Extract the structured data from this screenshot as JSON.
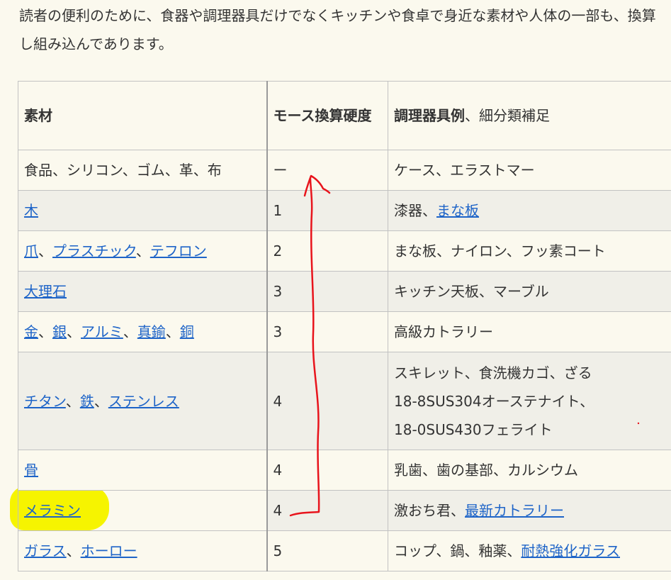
{
  "intro": {
    "text": "読者の便利のために、食器や調理器具だけでなくキッチンや食卓で身近な素材や人体の一部も、換算し組み込んであります。"
  },
  "table": {
    "headers": {
      "material": "素材",
      "hardness": "モース換算硬度",
      "examples_bold": "調理器具例",
      "examples_rest": "、細分類補足"
    },
    "rows": [
      {
        "material": [
          {
            "text": "食品、シリコン、ゴム、革、布",
            "link": false
          }
        ],
        "hardness": "ー",
        "examples": [
          {
            "text": "ケース、エラストマー",
            "link": false
          }
        ]
      },
      {
        "material": [
          {
            "text": "木",
            "link": true
          }
        ],
        "hardness": "1",
        "examples": [
          {
            "text": "漆器、",
            "link": false
          },
          {
            "text": "まな板",
            "link": true
          }
        ]
      },
      {
        "material": [
          {
            "text": "爪",
            "link": true
          },
          {
            "text": "、",
            "link": false
          },
          {
            "text": "プラスチック",
            "link": true
          },
          {
            "text": "、",
            "link": false
          },
          {
            "text": "テフロン",
            "link": true
          }
        ],
        "hardness": "2",
        "examples": [
          {
            "text": "まな板、ナイロン、フッ素コート",
            "link": false
          }
        ]
      },
      {
        "material": [
          {
            "text": "大理石",
            "link": true
          }
        ],
        "hardness": "3",
        "examples": [
          {
            "text": "キッチン天板、マーブル",
            "link": false
          }
        ]
      },
      {
        "material": [
          {
            "text": "金",
            "link": true
          },
          {
            "text": "、",
            "link": false
          },
          {
            "text": "銀",
            "link": true
          },
          {
            "text": "、",
            "link": false
          },
          {
            "text": "アルミ",
            "link": true
          },
          {
            "text": "、",
            "link": false
          },
          {
            "text": "真鍮",
            "link": true
          },
          {
            "text": "、",
            "link": false
          },
          {
            "text": "銅",
            "link": true
          }
        ],
        "hardness": "3",
        "examples": [
          {
            "text": "高級カトラリー",
            "link": false
          }
        ]
      },
      {
        "material": [
          {
            "text": "チタン",
            "link": true
          },
          {
            "text": "、",
            "link": false
          },
          {
            "text": "鉄",
            "link": true
          },
          {
            "text": "、",
            "link": false
          },
          {
            "text": "ステンレス",
            "link": true
          }
        ],
        "hardness": "4",
        "examples_lines": [
          "スキレット、食洗機カゴ、ざる",
          "18-8SUS304オーステナイト、",
          "18-0SUS430フェライト"
        ]
      },
      {
        "material": [
          {
            "text": "骨",
            "link": true
          }
        ],
        "hardness": "4",
        "examples": [
          {
            "text": "乳歯、歯の基部、カルシウム",
            "link": false
          }
        ]
      },
      {
        "material": [
          {
            "text": "メラミン",
            "link": true
          }
        ],
        "hardness": "4",
        "examples": [
          {
            "text": "激おち君、",
            "link": false
          },
          {
            "text": "最新カトラリー",
            "link": true
          }
        ]
      },
      {
        "material": [
          {
            "text": "ガラス",
            "link": true
          },
          {
            "text": "、",
            "link": false
          },
          {
            "text": "ホーロー",
            "link": true
          }
        ],
        "hardness": "5",
        "examples": [
          {
            "text": "コップ、鍋、釉薬、",
            "link": false
          },
          {
            "text": "耐熱強化ガラス",
            "link": true
          }
        ]
      }
    ]
  },
  "annotation": {
    "highlight_color": "#f6f400",
    "arrow_color": "#e8141c"
  }
}
